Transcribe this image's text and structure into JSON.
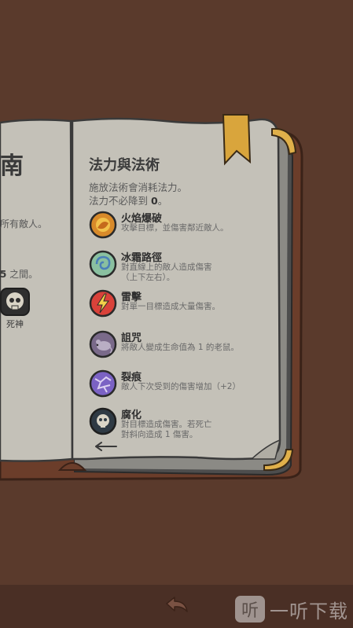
{
  "left_page": {
    "title_partial": "南",
    "line1_partial": "所有敵人。",
    "line2_before": "",
    "line2_number": "5",
    "line2_after": " 之間。",
    "death_label": "死神"
  },
  "right_page": {
    "title": "法力與法術",
    "intro_line1": "施放法術會消耗法力。",
    "intro_line2_before": "法力不必降到 ",
    "intro_line2_number": "0",
    "intro_line2_after": "。"
  },
  "spells": [
    {
      "name": "火焰爆破",
      "icon": "fire-orb-icon",
      "desc": "攻擊目標，並傷害鄰近敵人。"
    },
    {
      "name": "冰霜路徑",
      "icon": "frost-swirl-icon",
      "desc": "對直線上的敵人造成傷害\n（上下左右）。"
    },
    {
      "name": "雷擊",
      "icon": "lightning-icon",
      "desc": "對單一目標造成大量傷害。"
    },
    {
      "name": "詛咒",
      "icon": "rat-curse-icon",
      "desc": "將敵人變成生命值為 1 的老鼠。"
    },
    {
      "name": "裂痕",
      "icon": "crack-icon",
      "desc": "敵人下次受到的傷害增加（+2）"
    },
    {
      "name": "腐化",
      "icon": "decay-skull-icon",
      "desc": "對目標造成傷害。若死亡\n對斜向造成 1 傷害。"
    }
  ],
  "colors": {
    "background": "#5a3a2c",
    "bottom_bar": "#4a2f25",
    "page": "#c4c1b8",
    "cover": "#6b3d2a",
    "bookmark": "#d9a53c"
  },
  "watermark": {
    "logo": "听",
    "text": "一听下载"
  }
}
